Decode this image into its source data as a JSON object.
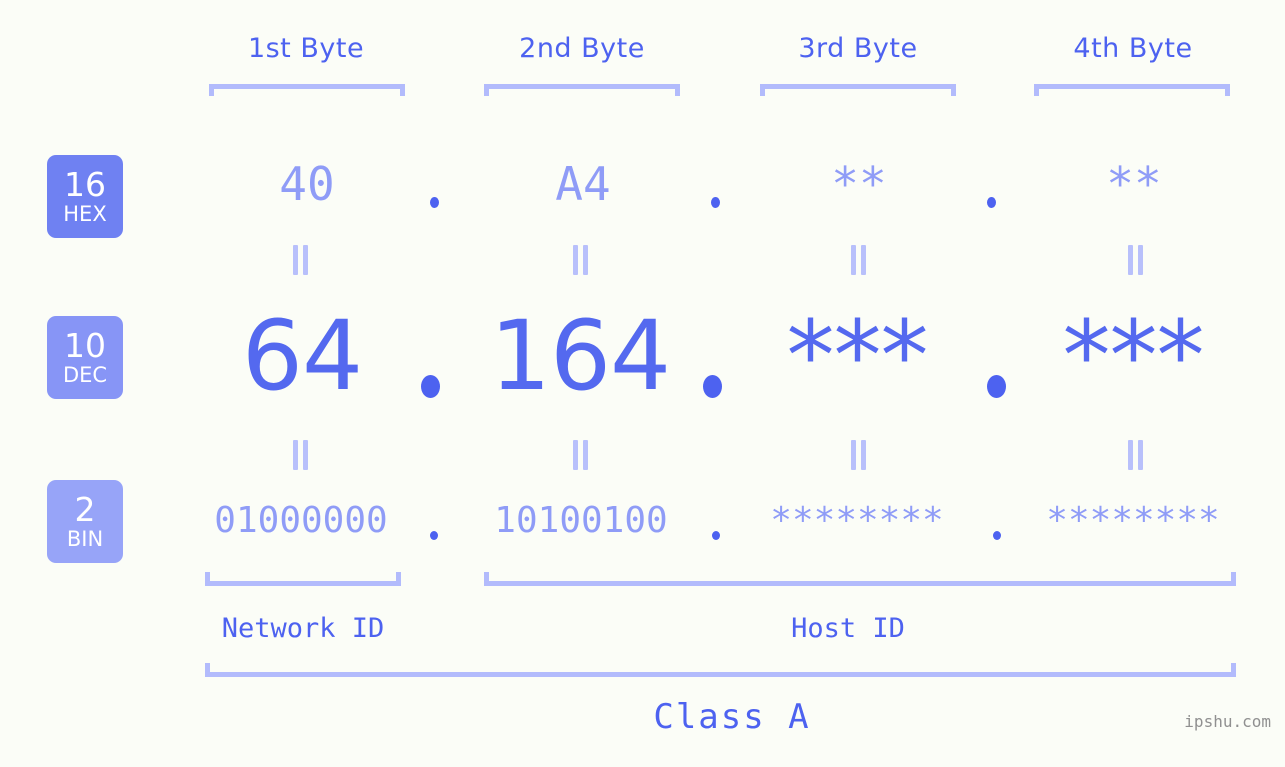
{
  "meta": {
    "background_color": "#fbfdf7",
    "accent_strong": "#4d62f0",
    "accent_medium": "#8f9cf7",
    "accent_light": "#b2bbfc",
    "watermark": "ipshu.com"
  },
  "byte_headers": [
    {
      "label": "1st Byte"
    },
    {
      "label": "2nd Byte"
    },
    {
      "label": "3rd Byte"
    },
    {
      "label": "4th Byte"
    }
  ],
  "bases": [
    {
      "number": "16",
      "abbr": "HEX",
      "color": "#6f81f2"
    },
    {
      "number": "10",
      "abbr": "DEC",
      "color": "#8795f6"
    },
    {
      "number": "2",
      "abbr": "BIN",
      "color": "#97a4f8"
    }
  ],
  "rows": {
    "hex": {
      "base_number": "16",
      "base_abbr": "HEX",
      "values": [
        "40",
        "A4",
        "**",
        "**"
      ],
      "separator": "."
    },
    "dec": {
      "base_number": "10",
      "base_abbr": "DEC",
      "values": [
        "64",
        "164",
        "***",
        "***"
      ],
      "separator": "."
    },
    "bin": {
      "base_number": "2",
      "base_abbr": "BIN",
      "values": [
        "01000000",
        "10100100",
        "********",
        "********"
      ],
      "separator": "."
    }
  },
  "equality_marker": "=",
  "segments": {
    "network_id": "Network ID",
    "host_id": "Host ID",
    "class": "Class A"
  }
}
